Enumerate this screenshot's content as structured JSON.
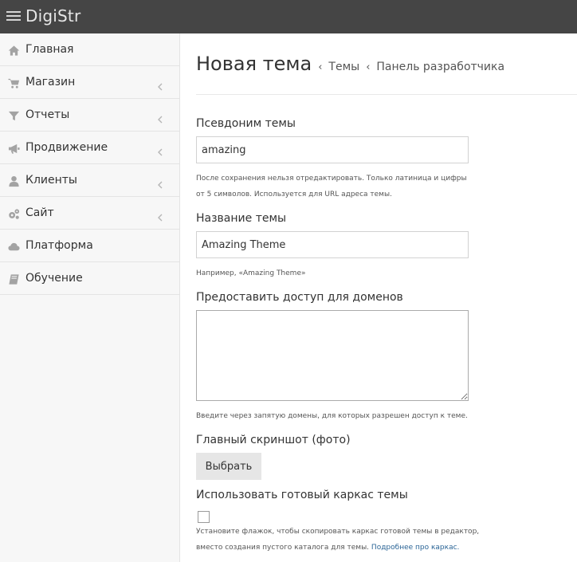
{
  "app": {
    "logo_text": "DigiStr"
  },
  "sidebar": {
    "items": [
      {
        "label": "Главная",
        "icon": "home-icon"
      },
      {
        "label": "Магазин",
        "icon": "cart-icon"
      },
      {
        "label": "Отчеты",
        "icon": "filter-icon"
      },
      {
        "label": "Продвижение",
        "icon": "megaphone-icon"
      },
      {
        "label": "Клиенты",
        "icon": "user-icon"
      },
      {
        "label": "Сайт",
        "icon": "gears-icon"
      },
      {
        "label": "Платформа",
        "icon": "cloud-icon"
      },
      {
        "label": "Обучение",
        "icon": "book-icon"
      }
    ]
  },
  "header": {
    "title": "Новая тема",
    "breadcrumbs": [
      "Темы",
      "Панель разработчика"
    ],
    "separator": "‹"
  },
  "form": {
    "alias": {
      "label": "Псевдоним темы",
      "value": "amazing",
      "help_line1": "После сохранения нельзя отредактировать. Только латиница и цифры",
      "help_line2": "от 5 символов. Используется для URL адреса темы."
    },
    "name": {
      "label": "Название темы",
      "value": "Amazing Theme",
      "help": "Например, «Amazing Theme»"
    },
    "domains": {
      "label": "Предоставить доступ для доменов",
      "value": "",
      "help": "Введите через запятую домены, для которых разрешен доступ к теме."
    },
    "screenshot": {
      "label": "Главный скриншот (фото)",
      "button_label": "Выбрать"
    },
    "skeleton": {
      "label": "Использовать готовый каркас темы",
      "checked": false,
      "help_line1": "Установите флажок, чтобы скопировать каркас готовой темы в редактор,",
      "help_line2_text": "вместо создания пустого каталога для темы.",
      "help_link": "Подробнее про каркас."
    }
  }
}
